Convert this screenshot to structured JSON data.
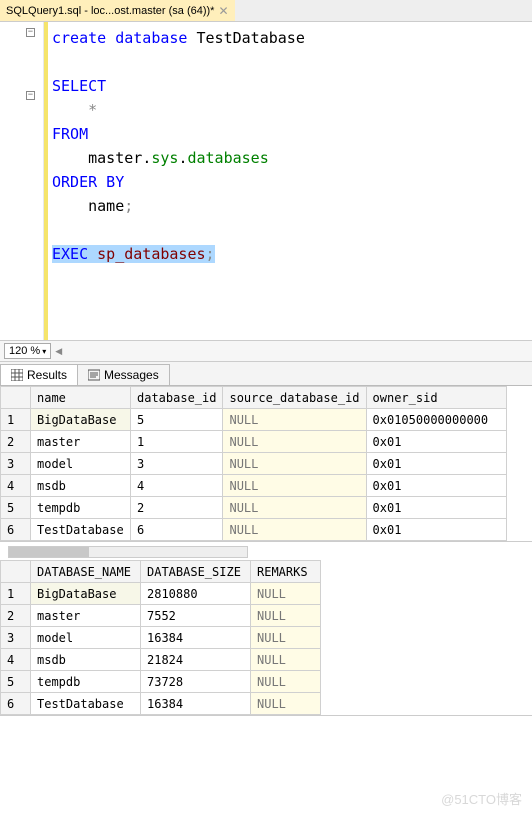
{
  "tab": {
    "title": "SQLQuery1.sql - loc...ost.master (sa (64))*"
  },
  "sql": {
    "l1_kw1": "create",
    "l1_kw2": "database",
    "l1_id": "TestDatabase",
    "l3_kw": "SELECT",
    "l4_star": "*",
    "l5_kw": "FROM",
    "l6_id": "master",
    "l6_dot1": ".",
    "l6_sys": "sys",
    "l6_dot2": ".",
    "l6_tbl": "databases",
    "l7_kw": "ORDER BY",
    "l8_id": "name",
    "l8_semi": ";",
    "l10_kw": "EXEC",
    "l10_sp": "sp_databases",
    "l10_semi": ";"
  },
  "zoom": {
    "value": "120 %"
  },
  "result_tabs": {
    "results": "Results",
    "messages": "Messages"
  },
  "grid1": {
    "headers": [
      "name",
      "database_id",
      "source_database_id",
      "owner_sid"
    ],
    "rows": [
      {
        "n": "1",
        "name": "BigDataBase",
        "id": "5",
        "src": "NULL",
        "own": "0x01050000000000"
      },
      {
        "n": "2",
        "name": "master",
        "id": "1",
        "src": "NULL",
        "own": "0x01"
      },
      {
        "n": "3",
        "name": "model",
        "id": "3",
        "src": "NULL",
        "own": "0x01"
      },
      {
        "n": "4",
        "name": "msdb",
        "id": "4",
        "src": "NULL",
        "own": "0x01"
      },
      {
        "n": "5",
        "name": "tempdb",
        "id": "2",
        "src": "NULL",
        "own": "0x01"
      },
      {
        "n": "6",
        "name": "TestDatabase",
        "id": "6",
        "src": "NULL",
        "own": "0x01"
      }
    ]
  },
  "grid2": {
    "headers": [
      "DATABASE_NAME",
      "DATABASE_SIZE",
      "REMARKS"
    ],
    "rows": [
      {
        "n": "1",
        "name": "BigDataBase",
        "size": "2810880",
        "rem": "NULL"
      },
      {
        "n": "2",
        "name": "master",
        "size": "7552",
        "rem": "NULL"
      },
      {
        "n": "3",
        "name": "model",
        "size": "16384",
        "rem": "NULL"
      },
      {
        "n": "4",
        "name": "msdb",
        "size": "21824",
        "rem": "NULL"
      },
      {
        "n": "5",
        "name": "tempdb",
        "size": "73728",
        "rem": "NULL"
      },
      {
        "n": "6",
        "name": "TestDatabase",
        "size": "16384",
        "rem": "NULL"
      }
    ]
  },
  "watermark": "@51CTO博客"
}
